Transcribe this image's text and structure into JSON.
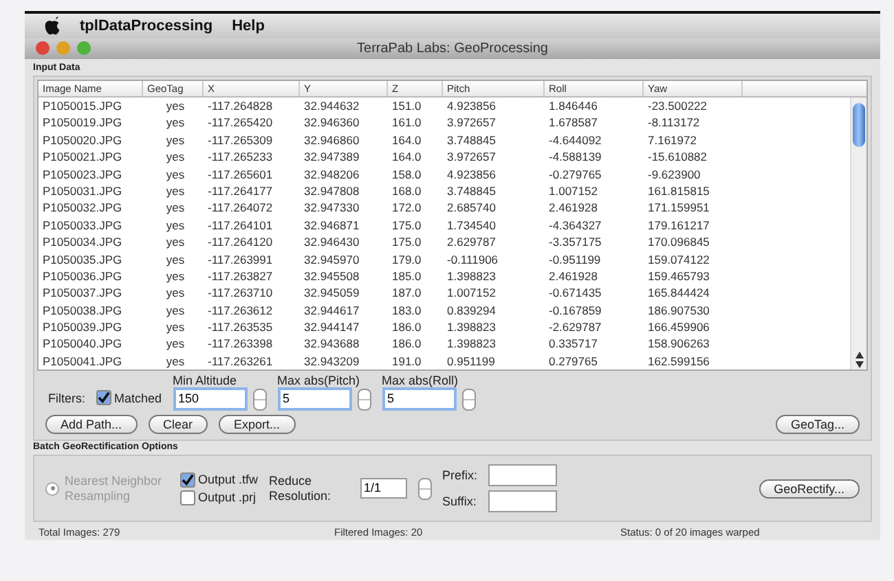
{
  "menu_bar": {
    "app_name": "tplDataProcessing",
    "items": [
      "Help"
    ]
  },
  "window": {
    "title": "TerraPab Labs: GeoProcessing"
  },
  "input_data": {
    "label": "Input Data",
    "table": {
      "columns": [
        "Image Name",
        "GeoTag",
        "X",
        "Y",
        "Z",
        "Pitch",
        "Roll",
        "Yaw"
      ],
      "rows": [
        [
          "P1050015.JPG",
          "yes",
          "-117.264828",
          "32.944632",
          "151.0",
          "4.923856",
          "1.846446",
          "-23.500222"
        ],
        [
          "P1050019.JPG",
          "yes",
          "-117.265420",
          "32.946360",
          "161.0",
          "3.972657",
          "1.678587",
          "-8.113172"
        ],
        [
          "P1050020.JPG",
          "yes",
          "-117.265309",
          "32.946860",
          "164.0",
          "3.748845",
          "-4.644092",
          "7.161972"
        ],
        [
          "P1050021.JPG",
          "yes",
          "-117.265233",
          "32.947389",
          "164.0",
          "3.972657",
          "-4.588139",
          "-15.610882"
        ],
        [
          "P1050023.JPG",
          "yes",
          "-117.265601",
          "32.948206",
          "158.0",
          "4.923856",
          "-0.279765",
          "-9.623900"
        ],
        [
          "P1050031.JPG",
          "yes",
          "-117.264177",
          "32.947808",
          "168.0",
          "3.748845",
          "1.007152",
          "161.815815"
        ],
        [
          "P1050032.JPG",
          "yes",
          "-117.264072",
          "32.947330",
          "172.0",
          "2.685740",
          "2.461928",
          "171.159951"
        ],
        [
          "P1050033.JPG",
          "yes",
          "-117.264101",
          "32.946871",
          "175.0",
          "1.734540",
          "-4.364327",
          "179.161217"
        ],
        [
          "P1050034.JPG",
          "yes",
          "-117.264120",
          "32.946430",
          "175.0",
          "2.629787",
          "-3.357175",
          "170.096845"
        ],
        [
          "P1050035.JPG",
          "yes",
          "-117.263991",
          "32.945970",
          "179.0",
          "-0.111906",
          "-0.951199",
          "159.074122"
        ],
        [
          "P1050036.JPG",
          "yes",
          "-117.263827",
          "32.945508",
          "185.0",
          "1.398823",
          "2.461928",
          "159.465793"
        ],
        [
          "P1050037.JPG",
          "yes",
          "-117.263710",
          "32.945059",
          "187.0",
          "1.007152",
          "-0.671435",
          "165.844424"
        ],
        [
          "P1050038.JPG",
          "yes",
          "-117.263612",
          "32.944617",
          "183.0",
          "0.839294",
          "-0.167859",
          "186.907530"
        ],
        [
          "P1050039.JPG",
          "yes",
          "-117.263535",
          "32.944147",
          "186.0",
          "1.398823",
          "-2.629787",
          "166.459906"
        ],
        [
          "P1050040.JPG",
          "yes",
          "-117.263398",
          "32.943688",
          "186.0",
          "1.398823",
          "0.335717",
          "158.906263"
        ],
        [
          "P1050041.JPG",
          "yes",
          "-117.263261",
          "32.943209",
          "191.0",
          "0.951199",
          "0.279765",
          "162.599156"
        ]
      ]
    },
    "filters": {
      "label": "Filters:",
      "matched": {
        "label": "Matched",
        "checked": true
      },
      "fields": [
        {
          "label": "Min Altitude",
          "value": "150"
        },
        {
          "label": "Max abs(Pitch)",
          "value": "5"
        },
        {
          "label": "Max abs(Roll)",
          "value": "5"
        }
      ]
    },
    "buttons": [
      "Add Path...",
      "Clear",
      "Export..."
    ],
    "geotag_button": "GeoTag..."
  },
  "batch_options": {
    "label": "Batch GeoRectification Options",
    "resampling": {
      "label": "Nearest Neighbor Resampling",
      "selected": true,
      "disabled": true
    },
    "outputs": [
      {
        "label": "Output .tfw",
        "checked": true
      },
      {
        "label": "Output .prj",
        "checked": false
      }
    ],
    "reduce_resolution": {
      "label": "Reduce Resolution:",
      "value": "1/1"
    },
    "prefix": {
      "label": "Prefix:"
    },
    "suffix": {
      "label": "Suffix:"
    },
    "georectify_button": "GeoRectify..."
  },
  "status_bar": [
    "Total Images: 279",
    "Filtered Images: 20",
    "Status: 0 of 20 images warped"
  ]
}
